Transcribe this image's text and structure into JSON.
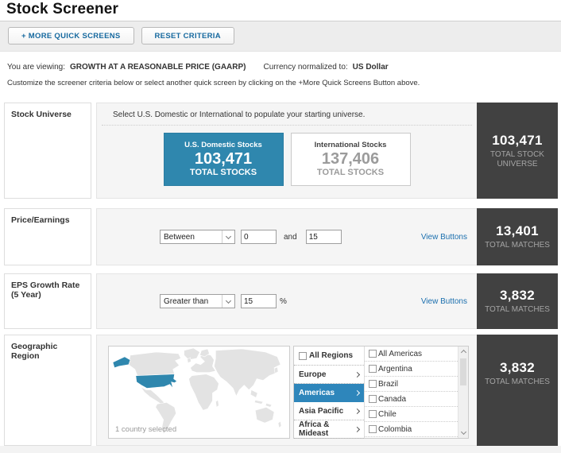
{
  "page": {
    "title": "Stock Screener"
  },
  "toolbar": {
    "more_quick_screens": "+ MORE QUICK SCREENS",
    "reset_criteria": "RESET CRITERIA"
  },
  "viewing": {
    "prefix": "You are viewing:",
    "screen_name": "GROWTH AT A REASONABLE PRICE (GAARP)",
    "currency_prefix": "Currency normalized to:",
    "currency": "US Dollar"
  },
  "instructions": "Customize the screener criteria below or select another quick screen by clicking on the +More Quick Screens Button above.",
  "colors": {
    "selected_card_blue": "#2f87ae",
    "selected_region_blue": "#2e86bb",
    "total_box_dark": "#414141",
    "link_blue": "#1b6fae"
  },
  "stock_universe": {
    "label": "Stock Universe",
    "instruction": "Select U.S. Domestic or International to populate your starting universe.",
    "domestic": {
      "title": "U.S. Domestic Stocks",
      "count": "103,471",
      "caption": "TOTAL STOCKS",
      "selected": true
    },
    "international": {
      "title": "International Stocks",
      "count": "137,406",
      "caption": "TOTAL STOCKS",
      "selected": false
    },
    "total": {
      "count": "103,471",
      "caption": "TOTAL STOCK UNIVERSE"
    }
  },
  "price_earnings": {
    "label": "Price/Earnings",
    "operator": "Between",
    "value1": "0",
    "conjunction": "and",
    "value2": "15",
    "view_buttons": "View Buttons",
    "total": {
      "count": "13,401",
      "caption": "TOTAL MATCHES"
    }
  },
  "eps_growth": {
    "label": "EPS Growth Rate (5 Year)",
    "operator": "Greater than",
    "value1": "15",
    "unit": "%",
    "view_buttons": "View Buttons",
    "total": {
      "count": "3,832",
      "caption": "TOTAL MATCHES"
    }
  },
  "geographic_region": {
    "label": "Geographic Region",
    "map_status": "1 country selected",
    "map_selected_country": "United States",
    "all_regions_label": "All Regions",
    "regions": [
      {
        "label": "Europe",
        "selected": false
      },
      {
        "label": "Americas",
        "selected": true
      },
      {
        "label": "Asia Pacific",
        "selected": false
      },
      {
        "label": "Africa & Mideast",
        "selected": false
      }
    ],
    "countries": [
      "All Americas",
      "Argentina",
      "Brazil",
      "Canada",
      "Chile",
      "Colombia",
      ""
    ],
    "total": {
      "count": "3,832",
      "caption": "TOTAL MATCHES"
    }
  }
}
